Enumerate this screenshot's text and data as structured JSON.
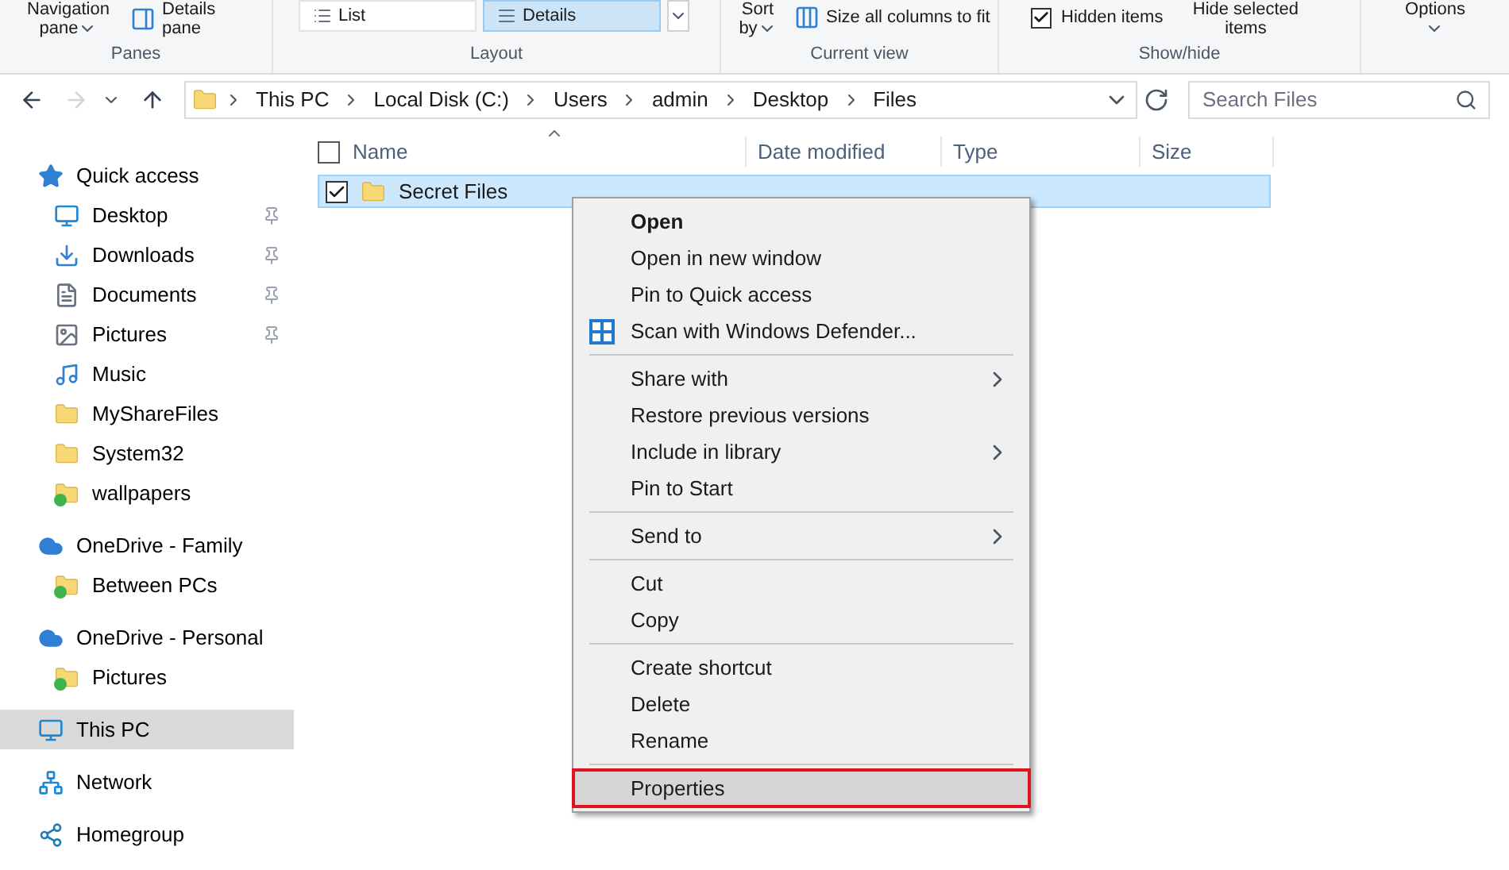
{
  "ribbon": {
    "groups": [
      {
        "label": "Panes",
        "buttons": [
          {
            "text": "Navigation pane",
            "dropdown": true
          },
          {
            "text": "Details pane",
            "dropdown": false
          }
        ]
      },
      {
        "label": "Layout",
        "layouts": [
          {
            "text": "List",
            "selected": false
          },
          {
            "text": "Details",
            "selected": true
          }
        ]
      },
      {
        "label": "Current view",
        "buttons": [
          {
            "text": "Sort by",
            "dropdown": true
          },
          {
            "text": "Size all columns to fit",
            "dropdown": false
          }
        ]
      },
      {
        "label": "Show/hide",
        "checkbox": {
          "text": "Hidden items",
          "checked": true
        },
        "button": {
          "text": "Hide selected items"
        }
      }
    ],
    "options": {
      "text": "Options",
      "dropdown": true
    }
  },
  "address_bar": {
    "path": [
      "This PC",
      "Local Disk (C:)",
      "Users",
      "admin",
      "Desktop",
      "Files"
    ],
    "search": {
      "placeholder": "Search Files"
    }
  },
  "sidebar": {
    "items": [
      {
        "label": "Quick access",
        "pinned": false,
        "selected": false,
        "children": [
          {
            "label": "Desktop",
            "pinned": true,
            "selected": false
          },
          {
            "label": "Downloads",
            "pinned": true,
            "selected": false
          },
          {
            "label": "Documents",
            "pinned": true,
            "selected": false
          },
          {
            "label": "Pictures",
            "pinned": true,
            "selected": false
          },
          {
            "label": "Music",
            "pinned": false,
            "selected": false
          },
          {
            "label": "MyShareFiles",
            "pinned": false,
            "selected": false
          },
          {
            "label": "System32",
            "pinned": false,
            "selected": false
          },
          {
            "label": "wallpapers",
            "pinned": false,
            "selected": false
          }
        ]
      },
      {
        "label": "OneDrive - Family",
        "pinned": false,
        "selected": false,
        "children": [
          {
            "label": "Between PCs",
            "pinned": false,
            "selected": false
          }
        ]
      },
      {
        "label": "OneDrive - Personal",
        "pinned": false,
        "selected": false,
        "children": [
          {
            "label": "Pictures",
            "pinned": false,
            "selected": false
          }
        ]
      },
      {
        "label": "This PC",
        "pinned": false,
        "selected": true
      },
      {
        "label": "Network",
        "pinned": false,
        "selected": false
      },
      {
        "label": "Homegroup",
        "pinned": false,
        "selected": false
      }
    ]
  },
  "table": {
    "columns": [
      "Name",
      "Date modified",
      "Type",
      "Size"
    ],
    "all_checked": false,
    "rows": [
      {
        "name": "Secret Files",
        "checked": true,
        "selected": true
      }
    ]
  },
  "context_menu": {
    "sections": [
      [
        {
          "label": "Open",
          "default": true,
          "submenu": false,
          "selected": false
        },
        {
          "label": "Open in new window",
          "default": false,
          "submenu": false,
          "selected": false
        },
        {
          "label": "Pin to Quick access",
          "default": false,
          "submenu": false,
          "selected": false
        },
        {
          "label": "Scan with Windows Defender...",
          "default": false,
          "submenu": false,
          "selected": false
        }
      ],
      [
        {
          "label": "Share with",
          "default": false,
          "submenu": true,
          "selected": false
        },
        {
          "label": "Restore previous versions",
          "default": false,
          "submenu": false,
          "selected": false
        },
        {
          "label": "Include in library",
          "default": false,
          "submenu": true,
          "selected": false
        },
        {
          "label": "Pin to Start",
          "default": false,
          "submenu": false,
          "selected": false
        }
      ],
      [
        {
          "label": "Send to",
          "default": false,
          "submenu": true,
          "selected": false
        }
      ],
      [
        {
          "label": "Cut",
          "default": false,
          "submenu": false,
          "selected": false
        },
        {
          "label": "Copy",
          "default": false,
          "submenu": false,
          "selected": false
        }
      ],
      [
        {
          "label": "Create shortcut",
          "default": false,
          "submenu": false,
          "selected": false
        },
        {
          "label": "Delete",
          "default": false,
          "submenu": false,
          "selected": false
        },
        {
          "label": "Rename",
          "default": false,
          "submenu": false,
          "selected": false
        }
      ],
      [
        {
          "label": "Properties",
          "default": false,
          "submenu": false,
          "selected": true
        }
      ]
    ]
  }
}
